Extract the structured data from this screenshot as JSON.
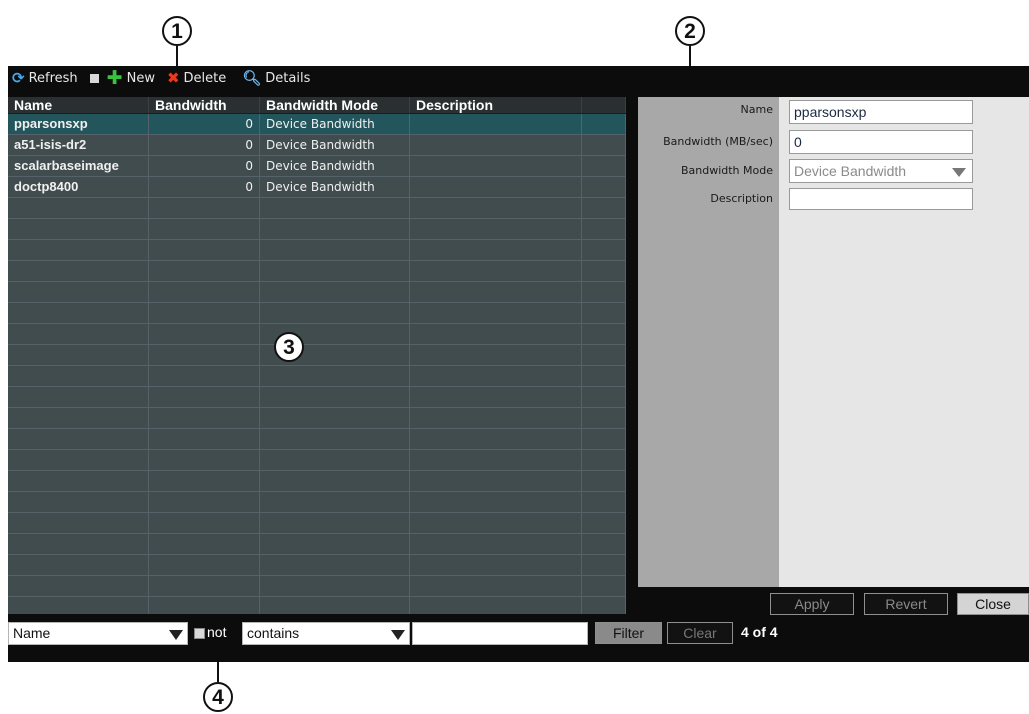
{
  "callouts": [
    "1",
    "2",
    "3",
    "4"
  ],
  "toolbar": {
    "refresh_label": "Refresh",
    "new_label": "New",
    "delete_label": "Delete",
    "details_label": "Details"
  },
  "grid": {
    "columns": [
      "Name",
      "Bandwidth",
      "Bandwidth Mode",
      "Description"
    ],
    "rows": [
      {
        "name": "pparsonsxp",
        "bandwidth": "0",
        "mode": "Device Bandwidth",
        "description": ""
      },
      {
        "name": "a51-isis-dr2",
        "bandwidth": "0",
        "mode": "Device Bandwidth",
        "description": ""
      },
      {
        "name": "scalarbaseimage",
        "bandwidth": "0",
        "mode": "Device Bandwidth",
        "description": ""
      },
      {
        "name": "doctp8400",
        "bandwidth": "0",
        "mode": "Device Bandwidth",
        "description": ""
      }
    ],
    "selected_row": 0
  },
  "details": {
    "name_label": "Name",
    "name_value": "pparsonsxp",
    "bandwidth_label": "Bandwidth (MB/sec)",
    "bandwidth_value": "0",
    "mode_label": "Bandwidth Mode",
    "mode_value": "Device Bandwidth",
    "description_label": "Description",
    "description_value": "",
    "apply_label": "Apply",
    "revert_label": "Revert",
    "close_label": "Close"
  },
  "filter": {
    "field_value": "Name",
    "not_label": "not",
    "not_checked": false,
    "operator_value": "contains",
    "text_value": "",
    "filter_label": "Filter",
    "clear_label": "Clear",
    "count_text": "4 of 4"
  },
  "colors": {
    "panel_bg": "#0c0c0c",
    "grid_bg": "#414c4f",
    "selected_row": "#23555c",
    "details_bg": "#e6e6e6"
  }
}
